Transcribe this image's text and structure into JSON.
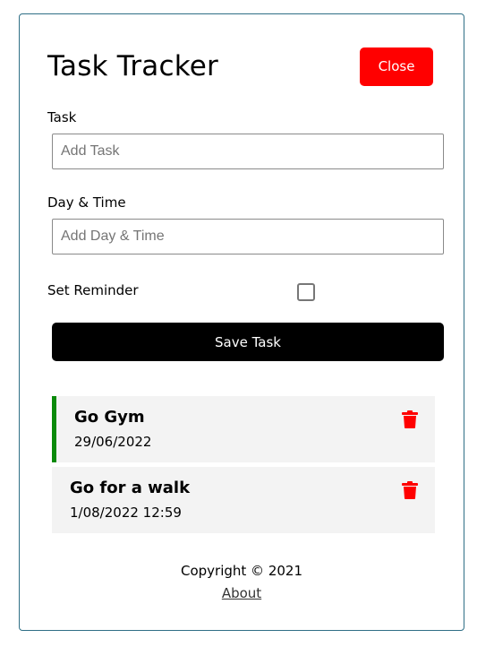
{
  "header": {
    "title": "Task Tracker",
    "close_label": "Close"
  },
  "form": {
    "task_label": "Task",
    "task_placeholder": "Add Task",
    "day_label": "Day & Time",
    "day_placeholder": "Add Day & Time",
    "reminder_label": "Set Reminder",
    "reminder_checked": false,
    "save_label": "Save Task"
  },
  "tasks": [
    {
      "text": "Go Gym",
      "day": "29/06/2022",
      "reminder": true
    },
    {
      "text": "Go for a walk",
      "day": "1/08/2022 12:59",
      "reminder": false
    }
  ],
  "footer": {
    "copyright": "Copyright © 2021",
    "about_link": "About"
  },
  "colors": {
    "danger": "#ff0000",
    "reminder_border": "#0a8a0a",
    "primary_button": "#000000",
    "container_border": "#2f6f86"
  },
  "icons": {
    "delete": "trash-icon"
  }
}
